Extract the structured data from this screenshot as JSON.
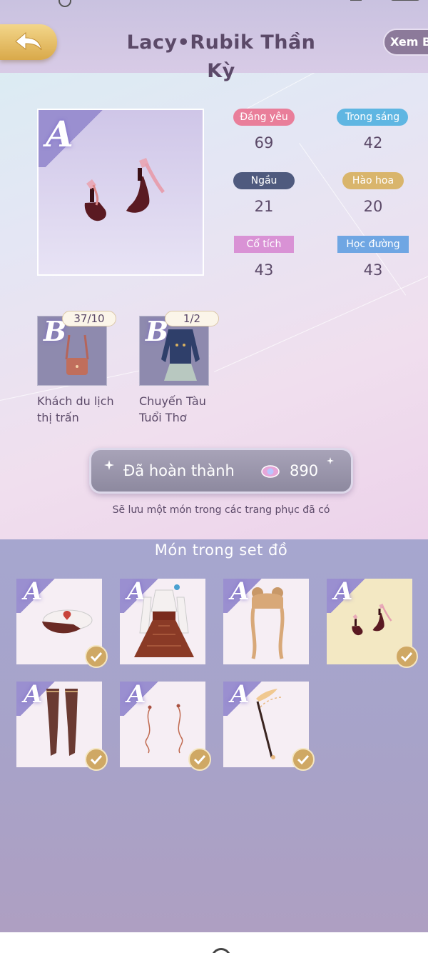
{
  "header": {
    "title": "Lacy•Rubik Thần Kỳ",
    "view_label": "Xem BS"
  },
  "item": {
    "grade": "A"
  },
  "stats": [
    {
      "label": "Đáng yêu",
      "value": "69",
      "color": "#e97e9a"
    },
    {
      "label": "Trong sáng",
      "value": "42",
      "color": "#5fb6e2"
    },
    {
      "label": "Ngầu",
      "value": "21",
      "color": "#4f5a7e"
    },
    {
      "label": "Hào hoa",
      "value": "20",
      "color": "#d9b56c"
    },
    {
      "label": "Cổ tích",
      "value": "43",
      "color": "#d992d5"
    },
    {
      "label": "Học đường",
      "value": "43",
      "color": "#6fa6e3"
    }
  ],
  "sources": [
    {
      "grade": "B",
      "count": "37/10",
      "name_line1": "Khách du lịch",
      "name_line2": "thị trấn"
    },
    {
      "grade": "B",
      "count": "1/2",
      "name_line1": "Chuyến Tàu",
      "name_line2": "Tuổi Thơ"
    }
  ],
  "complete_button": {
    "label": "Đã hoàn thành",
    "cost": "890"
  },
  "note": "Sẽ lưu một món trong các trang phục đã có",
  "set": {
    "title": "Món trong set đồ",
    "items": [
      {
        "grade": "A",
        "icon": "hat-icon",
        "owned": true,
        "selected": false
      },
      {
        "grade": "A",
        "icon": "dress-icon",
        "owned": false,
        "selected": false
      },
      {
        "grade": "A",
        "icon": "hair-icon",
        "owned": false,
        "selected": false
      },
      {
        "grade": "A",
        "icon": "shoes-icon",
        "owned": true,
        "selected": true
      },
      {
        "grade": "A",
        "icon": "stockings-icon",
        "owned": true,
        "selected": false
      },
      {
        "grade": "A",
        "icon": "earrings-icon",
        "owned": true,
        "selected": false
      },
      {
        "grade": "A",
        "icon": "wand-icon",
        "owned": true,
        "selected": false
      }
    ]
  },
  "colors": {
    "accent_gold": "#d9a94a",
    "check_gold": "#cfa864",
    "title_text": "#5b4968"
  }
}
